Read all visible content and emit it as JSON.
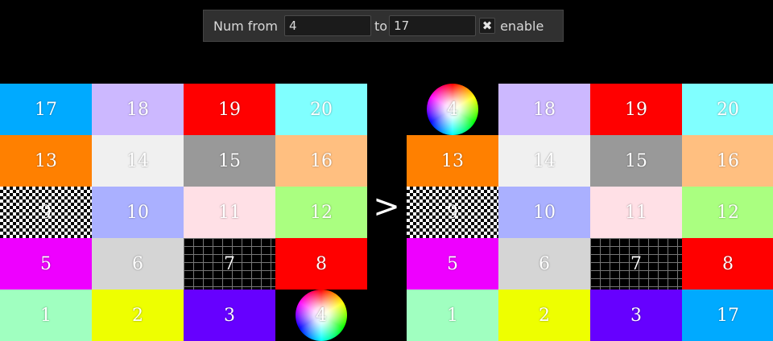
{
  "toolbar": {
    "from_label": "Num from",
    "from_value": "4",
    "to_label": "to",
    "to_value": "17",
    "check_glyph": "✖",
    "enable_label": "enable"
  },
  "arrow": ">",
  "left_grid": {
    "rows": [
      [
        {
          "n": "17",
          "bg": "#00aaff"
        },
        {
          "n": "18",
          "bg": "#ccb8ff"
        },
        {
          "n": "19",
          "bg": "#ff0000"
        },
        {
          "n": "20",
          "bg": "#80ffff"
        }
      ],
      [
        {
          "n": "13",
          "bg": "#ff8000"
        },
        {
          "n": "14",
          "bg": "#f0f0f0"
        },
        {
          "n": "15",
          "bg": "#999999"
        },
        {
          "n": "16",
          "bg": "#ffbf80"
        }
      ],
      [
        {
          "n": "9",
          "pattern": "checker"
        },
        {
          "n": "10",
          "bg": "#aab0ff"
        },
        {
          "n": "11",
          "bg": "#ffe0e6"
        },
        {
          "n": "12",
          "bg": "#aaff80"
        }
      ],
      [
        {
          "n": "5",
          "bg": "#ee00ff"
        },
        {
          "n": "6",
          "bg": "#d5d5d5"
        },
        {
          "n": "7",
          "pattern": "grid"
        },
        {
          "n": "8",
          "bg": "#ff0000"
        }
      ],
      [
        {
          "n": "1",
          "bg": "#a0ffc0"
        },
        {
          "n": "2",
          "bg": "#eeff00"
        },
        {
          "n": "3",
          "bg": "#6600ff"
        },
        {
          "n": "4",
          "pattern": "wheel"
        }
      ]
    ]
  },
  "right_grid": {
    "rows": [
      [
        {
          "n": "",
          "pattern": "empty"
        },
        {
          "n": "18",
          "bg": "#ccb8ff"
        },
        {
          "n": "19",
          "bg": "#ff0000"
        },
        {
          "n": "20",
          "bg": "#80ffff"
        }
      ],
      [
        {
          "n": "13",
          "bg": "#ff8000"
        },
        {
          "n": "14",
          "bg": "#f0f0f0"
        },
        {
          "n": "15",
          "bg": "#999999"
        },
        {
          "n": "16",
          "bg": "#ffbf80"
        }
      ],
      [
        {
          "n": "9",
          "pattern": "checker"
        },
        {
          "n": "10",
          "bg": "#aab0ff"
        },
        {
          "n": "11",
          "bg": "#ffe0e6"
        },
        {
          "n": "12",
          "bg": "#aaff80"
        }
      ],
      [
        {
          "n": "5",
          "bg": "#ee00ff"
        },
        {
          "n": "6",
          "bg": "#d5d5d5"
        },
        {
          "n": "7",
          "pattern": "grid"
        },
        {
          "n": "8",
          "bg": "#ff0000"
        }
      ],
      [
        {
          "n": "1",
          "bg": "#a0ffc0"
        },
        {
          "n": "2",
          "bg": "#eeff00"
        },
        {
          "n": "3",
          "bg": "#6600ff"
        },
        {
          "n": "17",
          "bg": "#00aaff"
        }
      ]
    ]
  },
  "right_moved_tile": "4"
}
